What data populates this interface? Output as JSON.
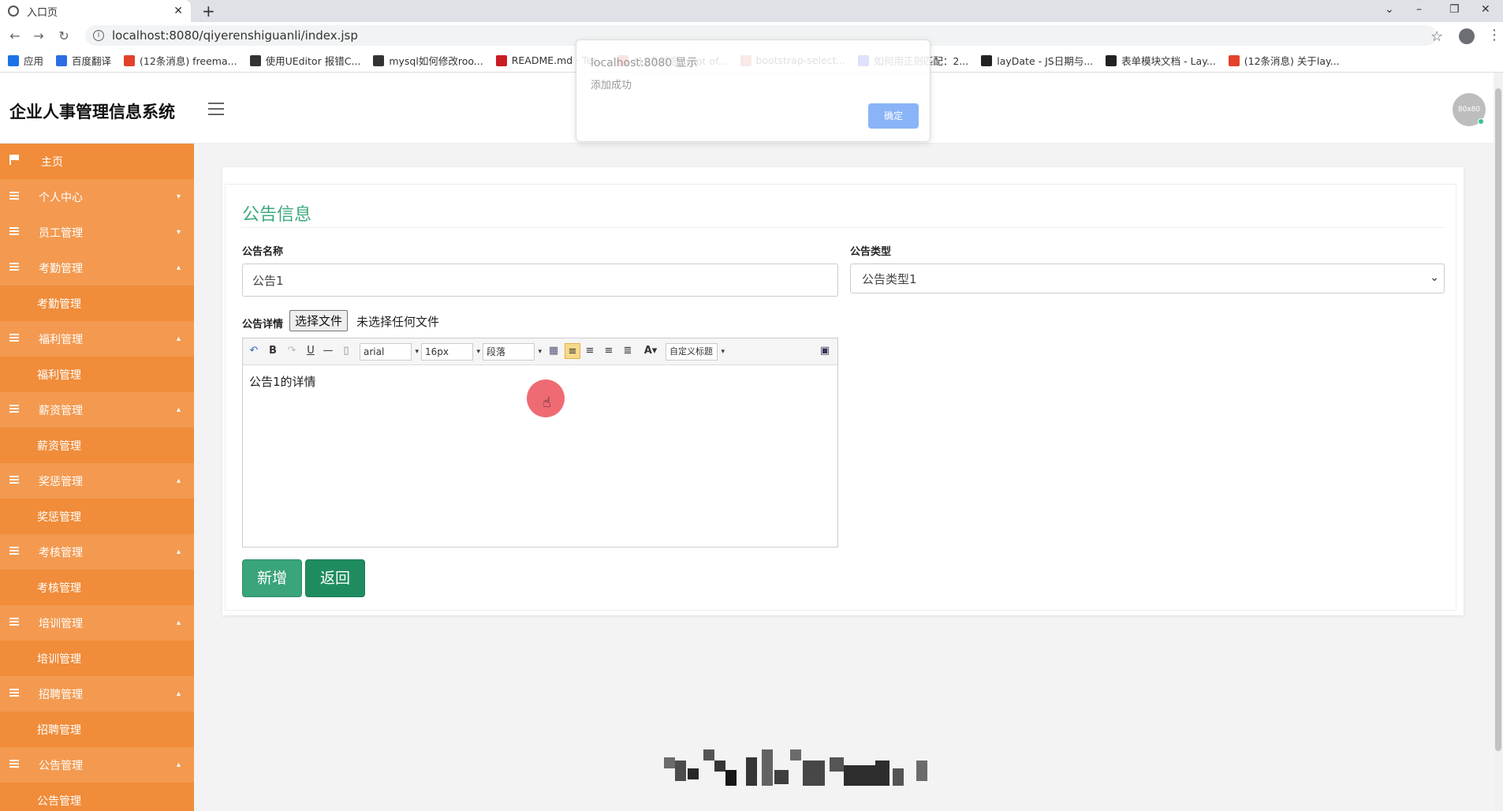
{
  "browser": {
    "tab_title": "入口页",
    "tab_close": "✕",
    "new_tab": "+",
    "url": "localhost:8080/qiyerenshiguanli/index.jsp",
    "bookmarks": [
      {
        "label": "应用",
        "color": "#1a73e8"
      },
      {
        "label": "百度翻译",
        "color": "#2b6de5"
      },
      {
        "label": "(12条消息) freema...",
        "color": "#e2422a"
      },
      {
        "label": "使用UEditor 报错C...",
        "color": "#333333"
      },
      {
        "label": "mysql如何修改roo...",
        "color": "#333333"
      },
      {
        "label": "README.md · Ter...",
        "color": "#c71d23"
      },
      {
        "label": "(12条消息) root of...",
        "color": "#e2422a"
      },
      {
        "label": "bootstrap-select...",
        "color": "#d46a6a"
      },
      {
        "label": "如何用正则匹配：2...",
        "color": "#2932e1"
      },
      {
        "label": "layDate - JS日期与...",
        "color": "#222222"
      },
      {
        "label": "表单模块文档 - Lay...",
        "color": "#222222"
      },
      {
        "label": "(12条消息) 关于lay...",
        "color": "#e2422a"
      }
    ]
  },
  "alert": {
    "title": "localhost:8080 显示",
    "message": "添加成功",
    "ok_label": "确定"
  },
  "header": {
    "brand": "企业人事管理信息系统",
    "avatar_text": "80x80"
  },
  "sidebar": {
    "home": "主页",
    "items": [
      {
        "label": "个人中心",
        "type": "group",
        "caret": "▾"
      },
      {
        "label": "员工管理",
        "type": "group",
        "caret": "▾"
      },
      {
        "label": "考勤管理",
        "type": "group",
        "caret": "▴"
      },
      {
        "label": "考勤管理",
        "type": "child"
      },
      {
        "label": "福利管理",
        "type": "group",
        "caret": "▴"
      },
      {
        "label": "福利管理",
        "type": "child"
      },
      {
        "label": "薪资管理",
        "type": "group",
        "caret": "▴"
      },
      {
        "label": "薪资管理",
        "type": "child"
      },
      {
        "label": "奖惩管理",
        "type": "group",
        "caret": "▴"
      },
      {
        "label": "奖惩管理",
        "type": "child"
      },
      {
        "label": "考核管理",
        "type": "group",
        "caret": "▴"
      },
      {
        "label": "考核管理",
        "type": "child"
      },
      {
        "label": "培训管理",
        "type": "group",
        "caret": "▴"
      },
      {
        "label": "培训管理",
        "type": "child"
      },
      {
        "label": "招聘管理",
        "type": "group",
        "caret": "▴"
      },
      {
        "label": "招聘管理",
        "type": "child"
      },
      {
        "label": "公告管理",
        "type": "group",
        "caret": "▴"
      },
      {
        "label": "公告管理",
        "type": "child"
      }
    ]
  },
  "form": {
    "title": "公告信息",
    "name_label": "公告名称",
    "name_value": "公告1",
    "type_label": "公告类型",
    "type_value": "公告类型1",
    "detail_label": "公告详情",
    "file_button": "选择文件",
    "file_status": "未选择任何文件",
    "editor": {
      "font": "arial",
      "size": "16px",
      "paragraph": "段落",
      "custom_title": "自定义标题",
      "content": "公告1的详情"
    },
    "add_button": "新增",
    "back_button": "返回"
  }
}
